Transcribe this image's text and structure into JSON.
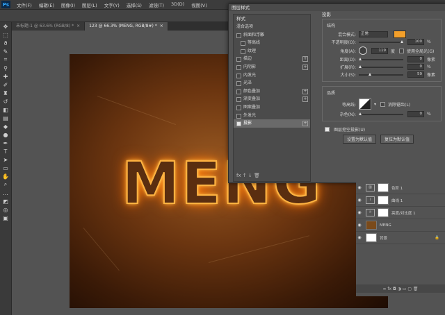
{
  "app": {
    "logo": "Ps"
  },
  "menu": [
    "文件(F)",
    "编辑(E)",
    "图像(I)",
    "图层(L)",
    "文字(Y)",
    "选择(S)",
    "滤镜(T)",
    "3D(D)",
    "视图(V)"
  ],
  "tabs": [
    {
      "label": "未标题-1 @ 63.6% (RGB/8) *",
      "active": false
    },
    {
      "label": "123 @ 66.3% (MENG, RGB/8#) *",
      "active": true
    }
  ],
  "canvas": {
    "text": "MENG"
  },
  "dialog": {
    "title": "图层样式",
    "list_header": "样式",
    "items": [
      {
        "label": "混合选项",
        "checkbox": false,
        "plus": false,
        "sub": false,
        "selected": false,
        "checked": false,
        "nocb": true
      },
      {
        "label": "斜面和浮雕",
        "checkbox": true,
        "plus": false,
        "sub": false,
        "selected": false,
        "checked": false
      },
      {
        "label": "等高线",
        "checkbox": true,
        "plus": false,
        "sub": true,
        "selected": false,
        "checked": false
      },
      {
        "label": "纹理",
        "checkbox": true,
        "plus": false,
        "sub": true,
        "selected": false,
        "checked": false
      },
      {
        "label": "描边",
        "checkbox": true,
        "plus": true,
        "sub": false,
        "selected": false,
        "checked": false
      },
      {
        "label": "内阴影",
        "checkbox": true,
        "plus": true,
        "sub": false,
        "selected": false,
        "checked": false
      },
      {
        "label": "内发光",
        "checkbox": true,
        "plus": false,
        "sub": false,
        "selected": false,
        "checked": false
      },
      {
        "label": "光泽",
        "checkbox": true,
        "plus": false,
        "sub": false,
        "selected": false,
        "checked": false
      },
      {
        "label": "颜色叠加",
        "checkbox": true,
        "plus": true,
        "sub": false,
        "selected": false,
        "checked": false
      },
      {
        "label": "渐变叠加",
        "checkbox": true,
        "plus": true,
        "sub": false,
        "selected": false,
        "checked": false
      },
      {
        "label": "图案叠加",
        "checkbox": true,
        "plus": false,
        "sub": false,
        "selected": false,
        "checked": false
      },
      {
        "label": "外发光",
        "checkbox": true,
        "plus": false,
        "sub": false,
        "selected": false,
        "checked": false
      },
      {
        "label": "投影",
        "checkbox": true,
        "plus": true,
        "sub": false,
        "selected": true,
        "checked": true
      }
    ],
    "footer_icons": "fx  ↑  ↓       🗑",
    "settings": {
      "section_title": "投影",
      "structure_label": "结构",
      "blend_mode_label": "混合模式:",
      "blend_mode_value": "正常",
      "shadow_color": "#f39f2a",
      "opacity_label": "不透明度(O):",
      "opacity_value": "100",
      "opacity_unit": "%",
      "angle_label": "角度(A):",
      "angle_value": "119",
      "angle_unit": "度",
      "global_light_label": "使用全局光(G)",
      "distance_label": "距离(D):",
      "distance_value": "0",
      "distance_unit": "像素",
      "spread_label": "扩展(R):",
      "spread_value": "0",
      "spread_unit": "%",
      "size_label": "大小(S):",
      "size_value": "59",
      "size_unit": "像素",
      "quality_label": "品质",
      "contour_label": "等高线:",
      "antialias_label": "消除锯齿(L)",
      "noise_label": "杂色(N):",
      "noise_value": "0",
      "noise_unit": "%",
      "knockout_label": "图层挖空投影(U)",
      "default_set_label": "设置为默认值",
      "default_reset_label": "复位为默认值"
    }
  },
  "layers": [
    {
      "name": "色阶 1",
      "type": "adjust",
      "icon": "▥"
    },
    {
      "name": "曲线 1",
      "type": "adjust",
      "icon": "⌇"
    },
    {
      "name": "亮度/对比度 1",
      "type": "adjust",
      "icon": "☼"
    },
    {
      "name": "MENG",
      "type": "text",
      "icon": ""
    },
    {
      "name": "背景",
      "type": "bg",
      "icon": ""
    }
  ],
  "layers_footer": "∞  fx  ◘  ◑  ▭  ▢  🗑"
}
